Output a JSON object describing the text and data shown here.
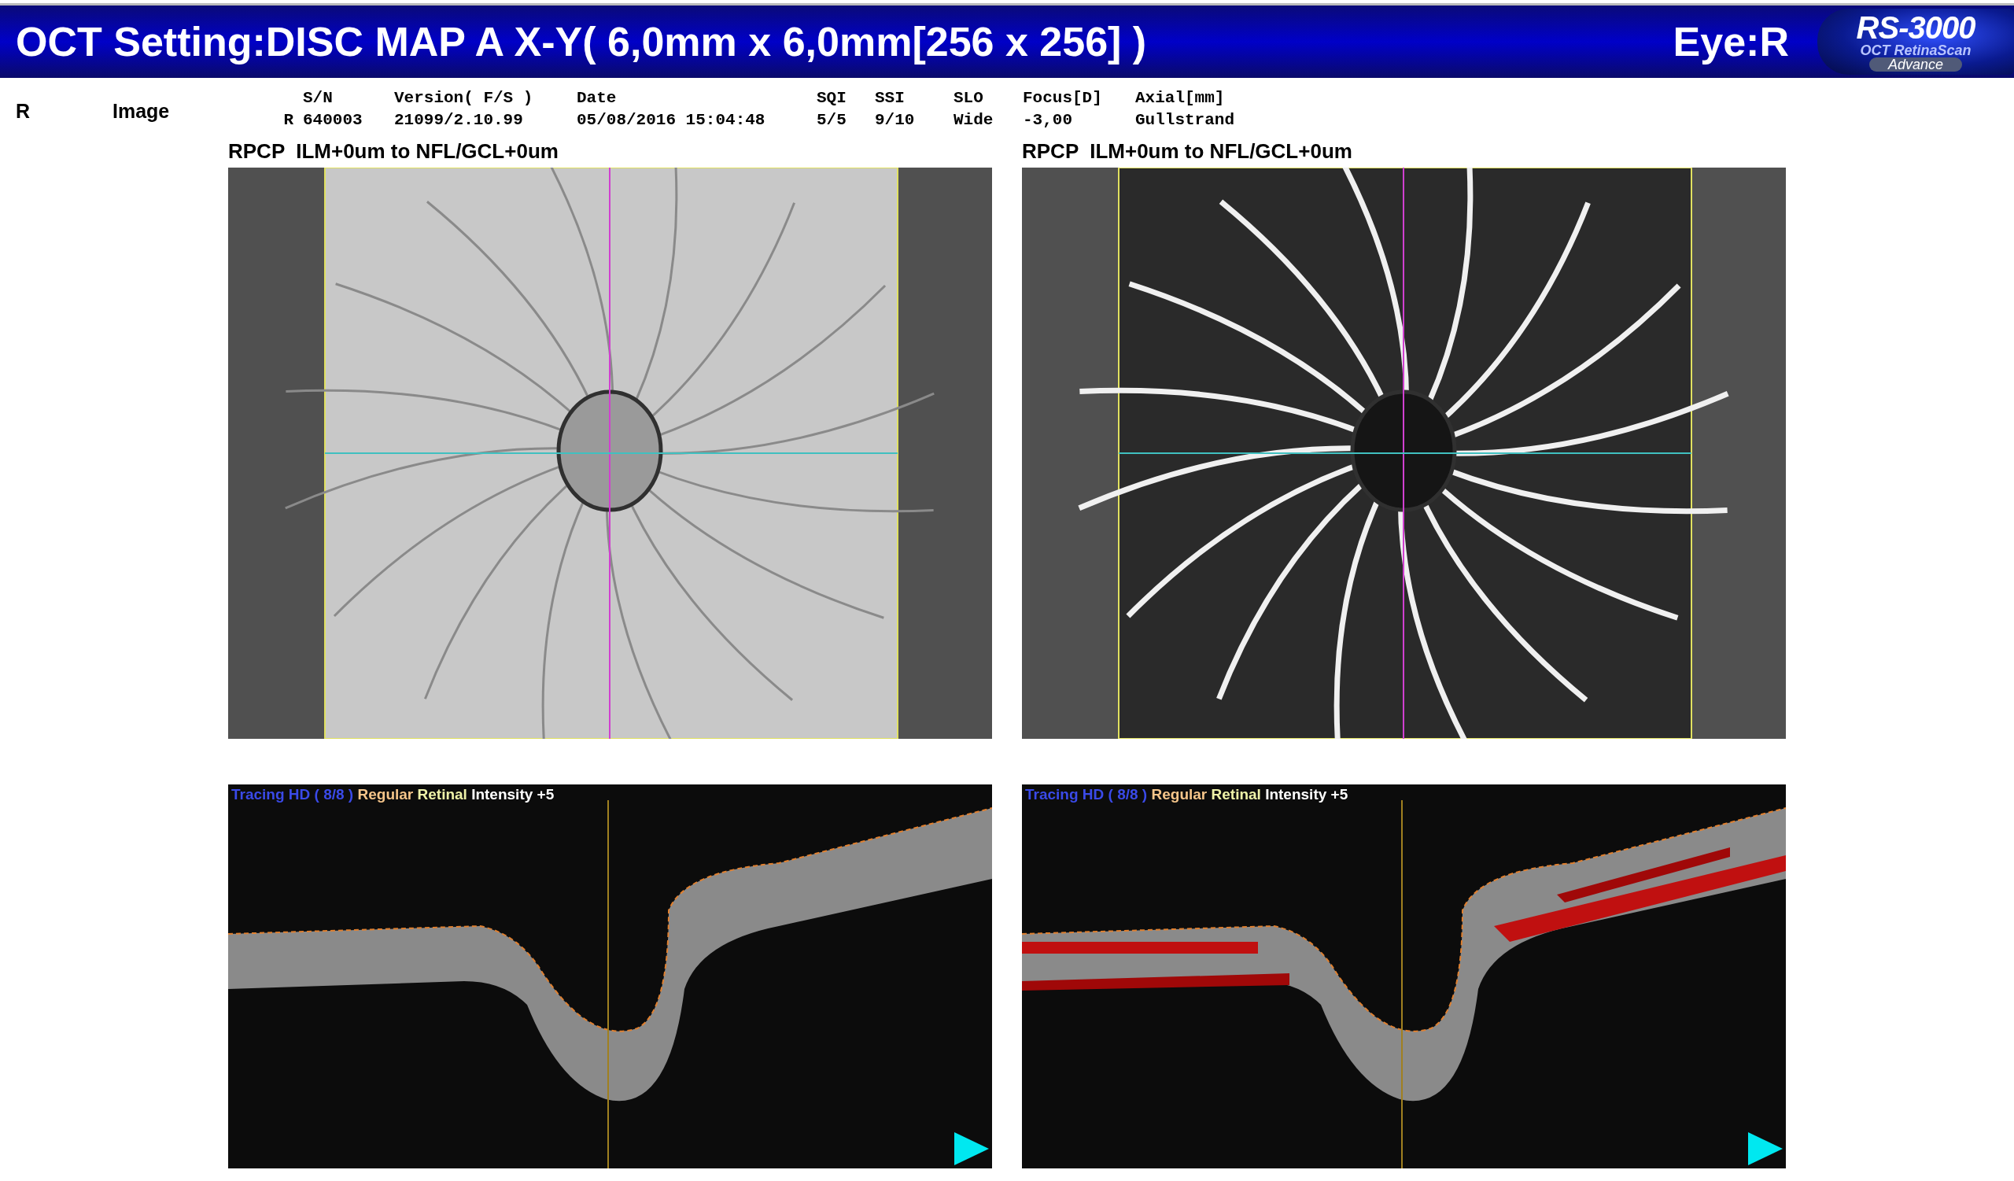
{
  "header": {
    "title": "OCT Setting:DISC MAP A X-Y( 6,0mm x 6,0mm[256 x 256] )",
    "eye": "Eye:R",
    "logo": {
      "model": "RS-3000",
      "line1": "OCT RetinaScan",
      "line2": "Advance"
    }
  },
  "info": {
    "eye_label": "R",
    "image_label": "Image",
    "columns": [
      {
        "value": "R"
      },
      {
        "header": "S/N",
        "value": "640003"
      },
      {
        "header": "Version( F/S )",
        "value": "21099/2.10.99"
      },
      {
        "header": "Date",
        "value": "05/08/2016 15:04:48"
      },
      {
        "header": "SQI",
        "value": "5/5"
      },
      {
        "header": "SSI",
        "value": "9/10"
      },
      {
        "header": "SLO",
        "value": "Wide"
      },
      {
        "header": "Focus[D]",
        "value": "-3,00"
      },
      {
        "header": "Axial[mm]",
        "value": "Gullstrand"
      }
    ]
  },
  "panels": [
    {
      "title": "RPCP  ILM+0um to NFL/GCL+0um",
      "kind": "structure",
      "bscan": {
        "flow_overlay": false,
        "labels": [
          {
            "text": "Tracing HD ( 8/8 )",
            "color": "#3a4ae8"
          },
          {
            "text": "Regular",
            "color": "#f5c58a"
          },
          {
            "text": "Retinal",
            "color": "#eef2a8"
          },
          {
            "text": "Intensity +5",
            "color": "#ffffff"
          }
        ]
      }
    },
    {
      "title": "RPCP  ILM+0um to NFL/GCL+0um",
      "kind": "angiography",
      "bscan": {
        "flow_overlay": true,
        "labels": [
          {
            "text": "Tracing HD ( 8/8 )",
            "color": "#3a4ae8"
          },
          {
            "text": "Regular",
            "color": "#f5c58a"
          },
          {
            "text": "Retinal",
            "color": "#eef2a8"
          },
          {
            "text": "Intensity +5",
            "color": "#ffffff"
          }
        ]
      }
    }
  ]
}
